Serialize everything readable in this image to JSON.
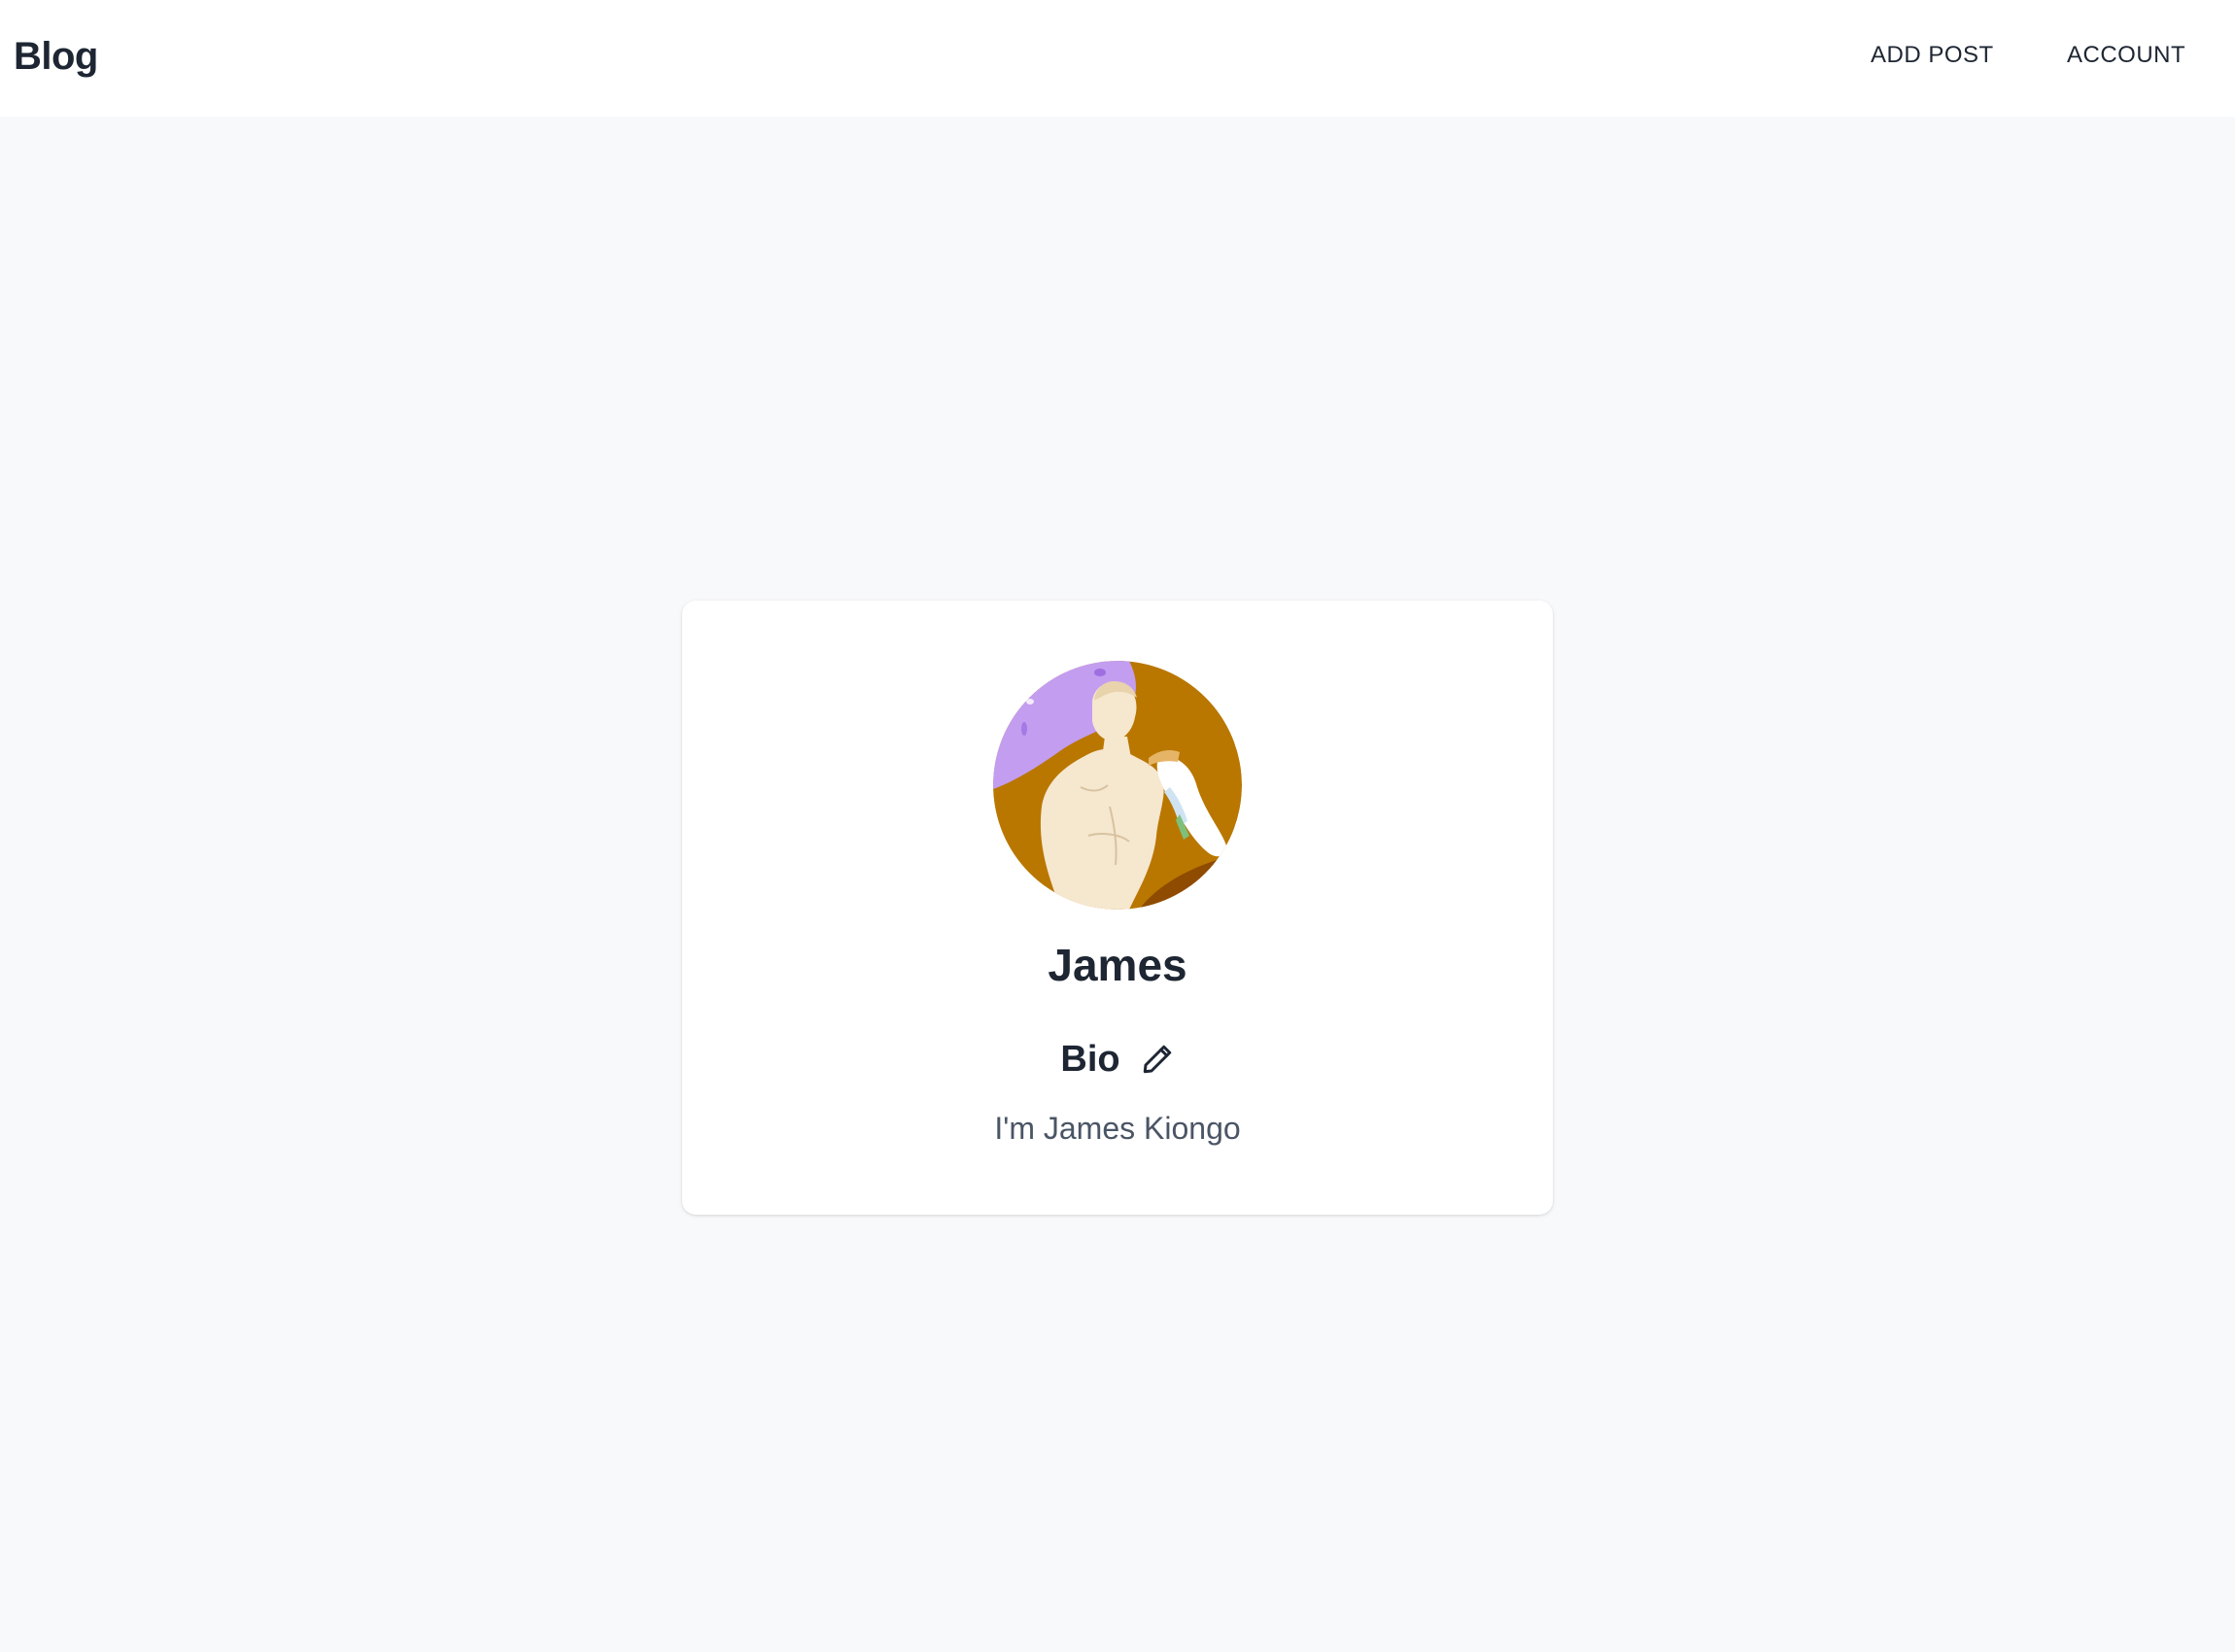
{
  "header": {
    "brand": "Blog",
    "nav": {
      "add_post": "ADD POST",
      "account": "ACCOUNT"
    }
  },
  "profile": {
    "avatar_icon": "statue-avatar",
    "name": "James",
    "bio_heading": "Bio",
    "edit_icon": "pencil-icon",
    "bio_text": "I'm James Kiongo"
  },
  "colors": {
    "background": "#f8f9fb",
    "card": "#ffffff",
    "text_primary": "#1e2633",
    "text_secondary": "#4a5565",
    "avatar_purple": "#c39df0",
    "avatar_orange": "#b97700"
  }
}
